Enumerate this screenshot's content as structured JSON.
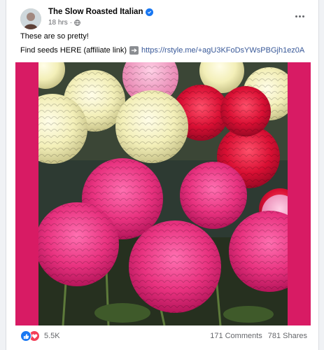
{
  "post": {
    "author": "The Slow Roasted Italian",
    "timestamp": "18 hrs",
    "separator": "·",
    "text_line1": "These are so pretty!",
    "text_line2_prefix": "Find seeds HERE (affiliate link)",
    "link": "https://rstyle.me/+agU3KFoDsYWsPBGjh1ez0A"
  },
  "icons": {
    "verified": "verified-badge-icon",
    "audience": "globe-icon",
    "menu": "more-horizontal-icon",
    "arrow": "right-arrow-emoji-icon",
    "like": "like-reaction-icon",
    "love": "love-reaction-icon"
  },
  "engagement": {
    "reactions_count": "5.5K",
    "comments_count": "171",
    "comments_label": "Comments",
    "shares_count": "781",
    "shares_label": "Shares"
  },
  "colors": {
    "brand_blue": "#1877f2",
    "link": "#385898",
    "photo_border": "#d81b64",
    "love_red": "#f33e58"
  }
}
